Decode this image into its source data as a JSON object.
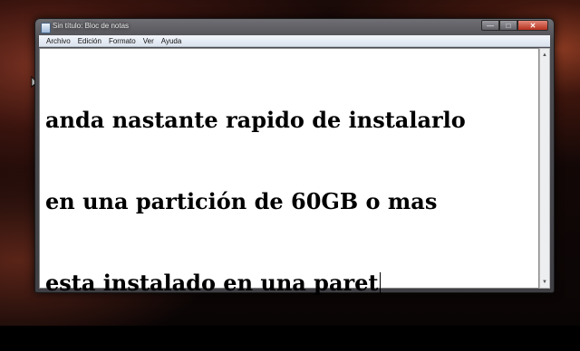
{
  "window": {
    "title": "Sin título: Bloc de notas",
    "controls": {
      "minimize": "—",
      "maximize": "□",
      "close": "✕"
    }
  },
  "menubar": {
    "items": [
      "Archivo",
      "Edición",
      "Formato",
      "Ver",
      "Ayuda"
    ]
  },
  "editor": {
    "lines": [
      "anda nastante rapido de instalarlo",
      "en una partición de 60GB o mas",
      "esta instalado en una paret"
    ]
  },
  "scrollbar": {
    "up_arrow": "▲",
    "down_arrow": "▼"
  }
}
